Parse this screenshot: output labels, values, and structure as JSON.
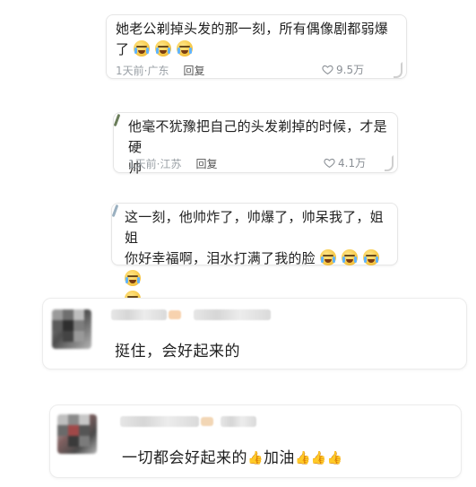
{
  "comments": [
    {
      "text_line1": "她老公剃掉头发的那一刻，所有偶像剧都弱爆",
      "text_line2": "了",
      "emoji_count": 3,
      "time": "1天前",
      "location": "广东",
      "reply_label": "回复",
      "likes": "9.5万"
    },
    {
      "text_line1": "他毫不犹豫把自己的头发剃掉的时候，才是硬",
      "text_line2": "帅",
      "time": "1天前",
      "location": "江苏",
      "reply_label": "回复",
      "likes": "4.1万"
    },
    {
      "text_line1": "这一刻，他帅炸了，帅爆了，帅呆我了，姐姐",
      "text_line2": "你好幸福啊，泪水打满了我的脸",
      "emoji_count": 5
    }
  ],
  "time_sep": "·",
  "user_comments": [
    {
      "text": "挺住，会好起来的"
    },
    {
      "text_part1": "一切都会好起来的",
      "text_part2": "加油",
      "thumbs_after_1": 1,
      "thumbs_after_2": 3
    }
  ],
  "icons": {
    "like": "heart-icon",
    "emoji": "crying-face-emoji",
    "thumb": "thumbs-up-emoji"
  },
  "colors": {
    "meta": "#9aa0a6",
    "text": "#222222",
    "emoji": "#f7c948"
  }
}
